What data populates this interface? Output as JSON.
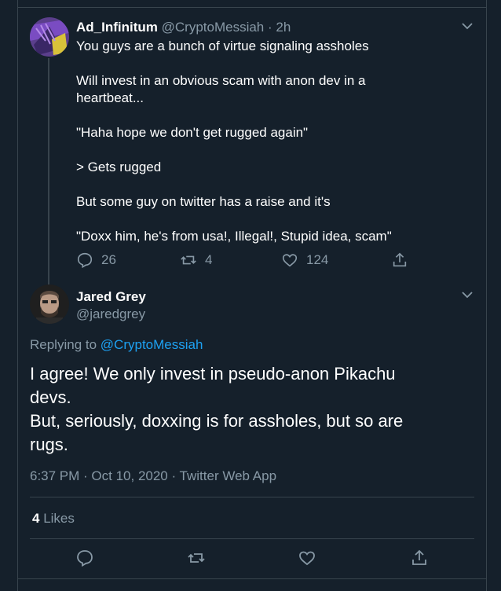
{
  "parent_tweet": {
    "display_name": "Ad_Infinitum",
    "handle": "@CryptoMessiah",
    "time": "· 2h",
    "lines": [
      "You guys are a bunch of virtue signaling assholes",
      "Will invest in an obvious scam with anon dev in a",
      "heartbeat...",
      "\"Haha hope we don't get rugged again\"",
      "> Gets rugged",
      "But some guy on twitter has a raise and it's",
      "\"Doxx him, he's from usa!, Illegal!, Stupid idea, scam\""
    ],
    "replies": "26",
    "retweets": "4",
    "likes": "124"
  },
  "reply_tweet": {
    "display_name": "Jared Grey",
    "handle": "@jaredgrey",
    "replying_to_prefix": "Replying to",
    "replying_to_handle": "@CryptoMessiah",
    "lines": [
      "I agree! We only invest in pseudo-anon Pikachu",
      "devs.",
      "But, seriously, doxxing is for assholes, but so are",
      "rugs."
    ],
    "timestamp": "6:37 PM · Oct 10, 2020 · Twitter Web App",
    "likes_count": "4",
    "likes_label": "Likes"
  },
  "colors": {
    "background": "#15202b",
    "muted": "#8899a6",
    "link": "#1da1f2",
    "border": "#38444d"
  }
}
